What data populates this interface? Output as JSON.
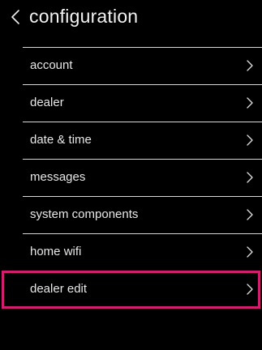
{
  "header": {
    "title": "configuration",
    "back_icon": "chevron-left-icon"
  },
  "menu": {
    "items": [
      {
        "label": "account",
        "icon": "chevron-right-icon"
      },
      {
        "label": "dealer",
        "icon": "chevron-right-icon"
      },
      {
        "label": "date & time",
        "icon": "chevron-right-icon"
      },
      {
        "label": "messages",
        "icon": "chevron-right-icon"
      },
      {
        "label": "system components",
        "icon": "chevron-right-icon"
      },
      {
        "label": "home wifi",
        "icon": "chevron-right-icon"
      },
      {
        "label": "dealer edit",
        "icon": "chevron-right-icon",
        "highlighted": true
      }
    ]
  },
  "colors": {
    "background": "#000000",
    "text": "#f0f0f0",
    "divider": "#d8d8d8",
    "highlight": "#d11e6e"
  }
}
